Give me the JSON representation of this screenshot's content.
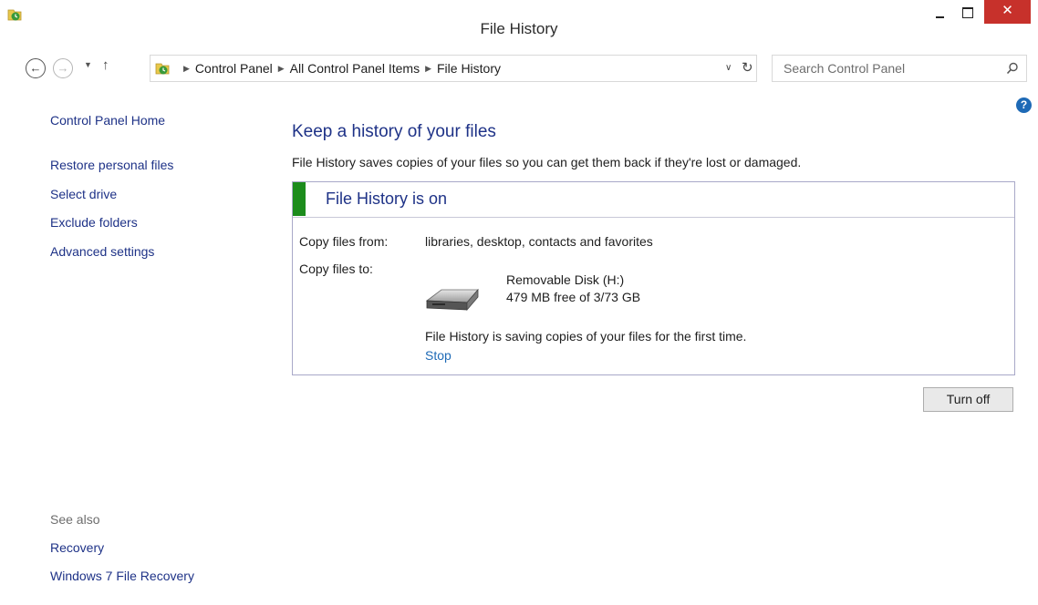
{
  "window": {
    "title": "File History",
    "close_glyph": "✕",
    "icon": "file-history-icon"
  },
  "navigation": {
    "back_glyph": "←",
    "forward_glyph": "→",
    "recent_glyph": "▼",
    "up_glyph": "↑",
    "breadcrumbs": [
      "Control Panel",
      "All Control Panel Items",
      "File History"
    ],
    "crumb_separator": "▶",
    "dropdown_glyph": "∨",
    "refresh_glyph": "↻",
    "search_placeholder": "Search Control Panel"
  },
  "help": {
    "glyph": "?"
  },
  "sidebar": {
    "items": [
      "Control Panel Home",
      "Restore personal files",
      "Select drive",
      "Exclude folders",
      "Advanced settings"
    ],
    "see_also_label": "See also",
    "see_also_items": [
      "Recovery",
      "Windows 7 File Recovery"
    ]
  },
  "main": {
    "heading": "Keep a history of your files",
    "description": "File History saves copies of your files so you can get them back if they're lost or damaged.",
    "status_title": "File History is on",
    "copy_from_label": "Copy files from:",
    "copy_from_value": "libraries, desktop, contacts and favorites",
    "copy_to_label": "Copy files to:",
    "drive_name": "Removable Disk (H:)",
    "drive_space": "479 MB free of 3/73 GB",
    "saving_message": "File History is saving copies of your files for the first time.",
    "stop_label": "Stop",
    "turn_off_label": "Turn off"
  },
  "colors": {
    "link": "#1e3287",
    "status_green": "#1c8c1c",
    "close_red": "#c7312b"
  }
}
